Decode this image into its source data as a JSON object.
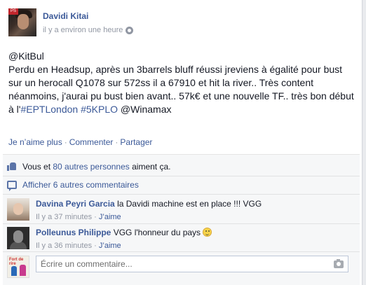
{
  "post": {
    "author": "Davidi Kitai",
    "avatar_tag": "PS",
    "timestamp": "il y a environ une heure",
    "privacy_icon": "globe-icon",
    "text_line1": "@KitBul",
    "text_part1": "Perdu en Headsup, après un 3barrels bluff réussi jreviens à égalité pour bust sur un herocall Q1078 sur 572ss il a 67910 et hit la river.. Très content néanmoins, j'aurai pu bust bien avant.. 57k€ et une nouvelle TF.. très bon début à l'",
    "hashtag1": "#EPTLondon",
    "hashtag2": "#5KPLO",
    "text_end": "@Winamax"
  },
  "actions": {
    "unlike": "Je n’aime plus",
    "comment": "Commenter",
    "share": "Partager",
    "separator": "·"
  },
  "likes": {
    "you": "Vous et",
    "others_link": "80 autres personnes",
    "suffix": "aiment ça."
  },
  "more_comments": "Afficher 6 autres commentaires",
  "comments": [
    {
      "name": "Davina Peyri Garcia",
      "text": "la Davidi machine est en place !!! VGG",
      "time": "Il y a 37 minutes",
      "like": "J’aime",
      "dot": "·"
    },
    {
      "name": "Polleunus Philippe",
      "text": "VGG l'honneur du pays",
      "time": "Il y a 36 minutes",
      "like": "J’aime",
      "dot": "·"
    }
  ],
  "composer": {
    "placeholder": "Écrire un commentaire...",
    "avatar_text": "Fort de rire"
  },
  "colors": {
    "link": "#3b5998",
    "meta": "#9197a3",
    "ufi_bg": "#f6f7f8"
  }
}
